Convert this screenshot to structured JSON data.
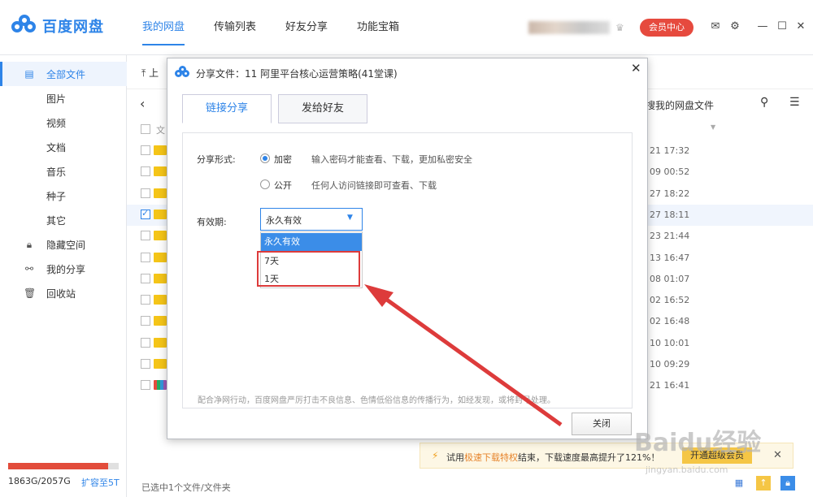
{
  "app": {
    "logo_text": "百度网盘",
    "nav": [
      "我的网盘",
      "传输列表",
      "好友分享",
      "功能宝箱"
    ],
    "vip_label": "会员中心"
  },
  "sidebar": {
    "items": [
      {
        "label": "全部文件",
        "icon": "file-icon"
      },
      {
        "label": "图片"
      },
      {
        "label": "视频"
      },
      {
        "label": "文档"
      },
      {
        "label": "音乐"
      },
      {
        "label": "种子"
      },
      {
        "label": "其它"
      },
      {
        "label": "隐藏空间",
        "icon": "lock-icon"
      },
      {
        "label": "我的分享",
        "icon": "share-icon"
      },
      {
        "label": "回收站",
        "icon": "trash-icon"
      }
    ],
    "storage_text": "1863G/2057G",
    "storage_link": "扩容至5T",
    "storage_fraction": 0.906
  },
  "main": {
    "upload_label": "上",
    "search_label": "搜我的网盘文件",
    "header_partial": "文",
    "dates": [
      "21 17:32",
      "09 00:52",
      "27 18:22",
      "27 18:11",
      "23 21:44",
      "13 16:47",
      "08 01:07",
      "02 16:52",
      "02 16:48",
      "10 10:01",
      "10 09:29",
      "21 16:41"
    ],
    "status": "已选中1个文件/文件夹"
  },
  "notice": {
    "prefix": "试用",
    "highlight": "极速下载特权",
    "suffix": "结束，下载速度最高提升了121%！",
    "button": "开通超级会员"
  },
  "dialog": {
    "title": "分享文件：11 阿里平台核心运营策略(41堂课)",
    "tabs": [
      "链接分享",
      "发给好友"
    ],
    "share_form_label": "分享形式:",
    "option_private": "加密",
    "option_private_desc": "输入密码才能查看、下载，更加私密安全",
    "option_public": "公开",
    "option_public_desc": "任何人访问链接即可查看、下载",
    "validity_label": "有效期:",
    "validity_value": "永久有效",
    "validity_options": [
      "永久有效",
      "7天",
      "1天"
    ],
    "disclaimer": "配合净网行动，百度网盘严厉打击不良信息、色情低俗信息的传播行为，如经发现，或将封号处理。",
    "close_button": "关闭"
  },
  "watermark": {
    "big": "Baidu经验",
    "small": "jingyan.baidu.com"
  },
  "colors": {
    "accent": "#2e84e8",
    "vip": "#e64a3e",
    "annotation": "#dd3b3b"
  }
}
